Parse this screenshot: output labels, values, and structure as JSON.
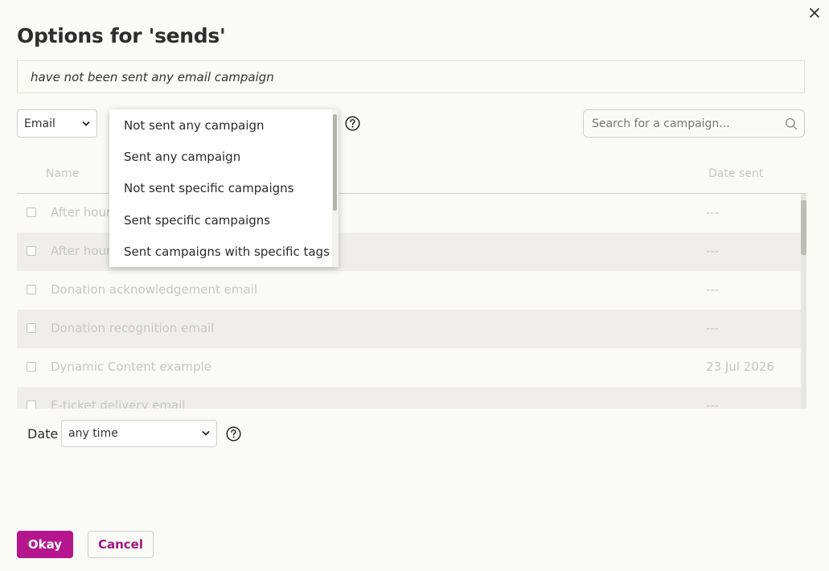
{
  "dialog": {
    "title": "Options for 'sends'",
    "summary": "have not been sent any email campaign"
  },
  "filters": {
    "channel_value": "Email",
    "search_placeholder": "Search for a campaign..."
  },
  "dropdown": {
    "options": [
      "Not sent any campaign",
      "Sent any campaign",
      "Not sent specific campaigns",
      "Sent specific campaigns",
      "Sent campaigns with specific tags"
    ]
  },
  "table": {
    "headers": {
      "name": "Name",
      "date": "Date sent"
    },
    "rows": [
      {
        "name": "After hours",
        "date": "---"
      },
      {
        "name": "After hours",
        "date": "---"
      },
      {
        "name": "Donation acknowledgement email",
        "date": "---"
      },
      {
        "name": "Donation recognition email",
        "date": "---"
      },
      {
        "name": "Dynamic Content example",
        "date": "23 Jul 2026"
      },
      {
        "name": "E-ticket delivery email",
        "date": "---"
      }
    ]
  },
  "date_filter": {
    "label": "Date",
    "value": "any time"
  },
  "actions": {
    "okay": "Okay",
    "cancel": "Cancel"
  },
  "colors": {
    "primary": "#b5168d",
    "background": "#fafaf6",
    "row_shade": "#efeeeb"
  }
}
